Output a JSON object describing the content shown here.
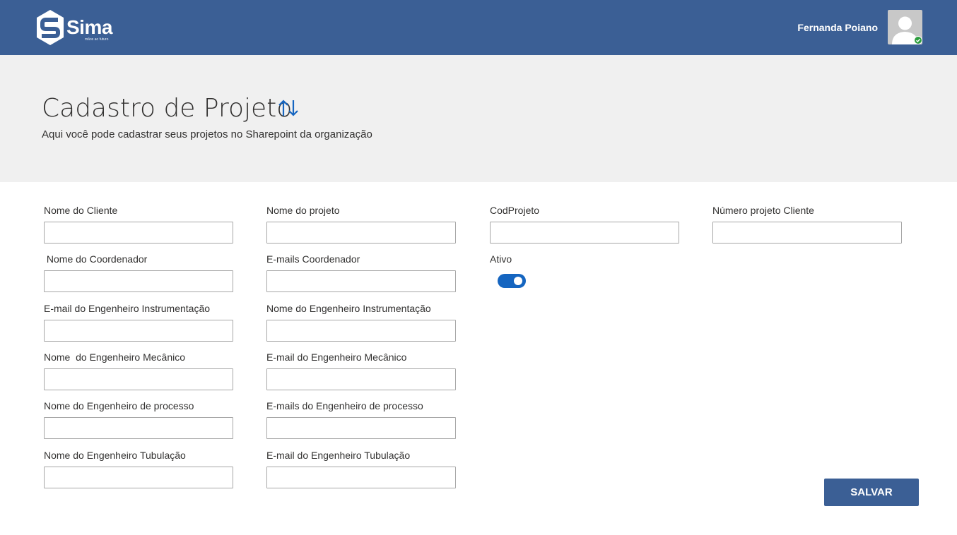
{
  "header": {
    "logo_text": "Sima",
    "logo_tagline": "mãos ao futuro",
    "user_name": "Fernanda Poiano",
    "colors": {
      "bar": "#3b5f95",
      "status_online": "#2e9e3f"
    }
  },
  "page": {
    "title": "Cadastro de Projeto",
    "subtitle": "Aqui você pode cadastrar seus projetos no Sharepoint da organização",
    "title_icon": "sort-arrows-icon"
  },
  "form": {
    "fields": {
      "nome_cliente": {
        "label": "Nome do Cliente",
        "value": ""
      },
      "nome_projeto": {
        "label": "Nome do projeto",
        "value": ""
      },
      "cod_projeto": {
        "label": "CodProjeto",
        "value": ""
      },
      "numero_projeto_cliente": {
        "label": "Número projeto Cliente",
        "value": ""
      },
      "nome_coordenador": {
        "label": " Nome do Coordenador",
        "value": ""
      },
      "emails_coordenador": {
        "label": "E-mails Coordenador",
        "value": ""
      },
      "email_eng_instrumentacao": {
        "label": "E-mail do Engenheiro Instrumentação",
        "value": ""
      },
      "nome_eng_instrumentacao": {
        "label": "Nome do Engenheiro Instrumentação",
        "value": ""
      },
      "nome_eng_mecanico": {
        "label": "Nome  do Engenheiro Mecânico",
        "value": ""
      },
      "email_eng_mecanico": {
        "label": "E-mail do Engenheiro Mecânico",
        "value": ""
      },
      "nome_eng_processo": {
        "label": "Nome do Engenheiro de processo",
        "value": ""
      },
      "emails_eng_processo": {
        "label": "E-mails do Engenheiro de processo",
        "value": ""
      },
      "nome_eng_tubulacao": {
        "label": "Nome do Engenheiro Tubulação",
        "value": ""
      },
      "email_eng_tubulacao": {
        "label": "E-mail do Engenheiro Tubulação",
        "value": ""
      }
    },
    "ativo": {
      "label": "Ativo",
      "checked": true,
      "color": "#1565c0"
    },
    "save_label": "SALVAR"
  }
}
